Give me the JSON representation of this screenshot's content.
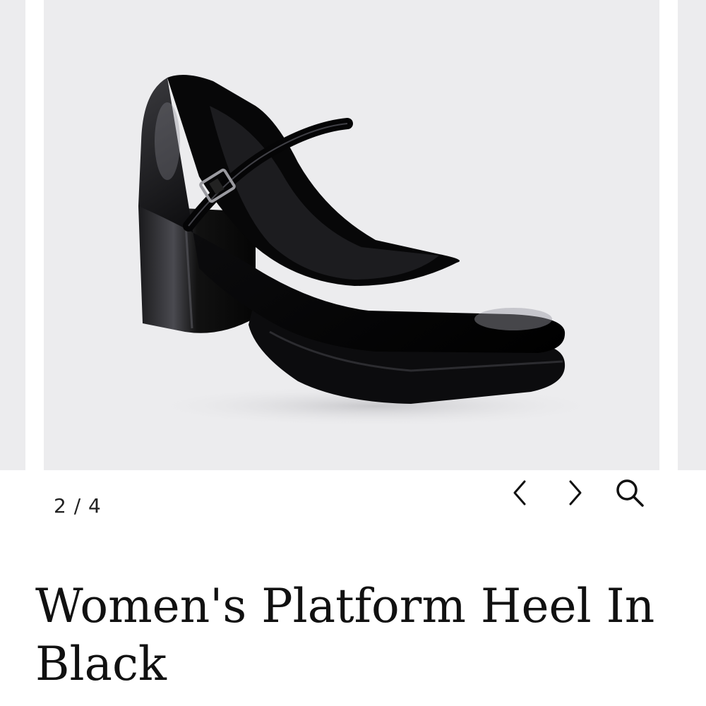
{
  "gallery": {
    "counter": "2 / 4",
    "image_alt": "Black patent leather platform Mary Jane heel",
    "prev_icon": "chevron-left-icon",
    "next_icon": "chevron-right-icon",
    "zoom_icon": "magnifier-icon",
    "background_color": "#ececee"
  },
  "product": {
    "title": "Women's Platform Heel In Black"
  }
}
